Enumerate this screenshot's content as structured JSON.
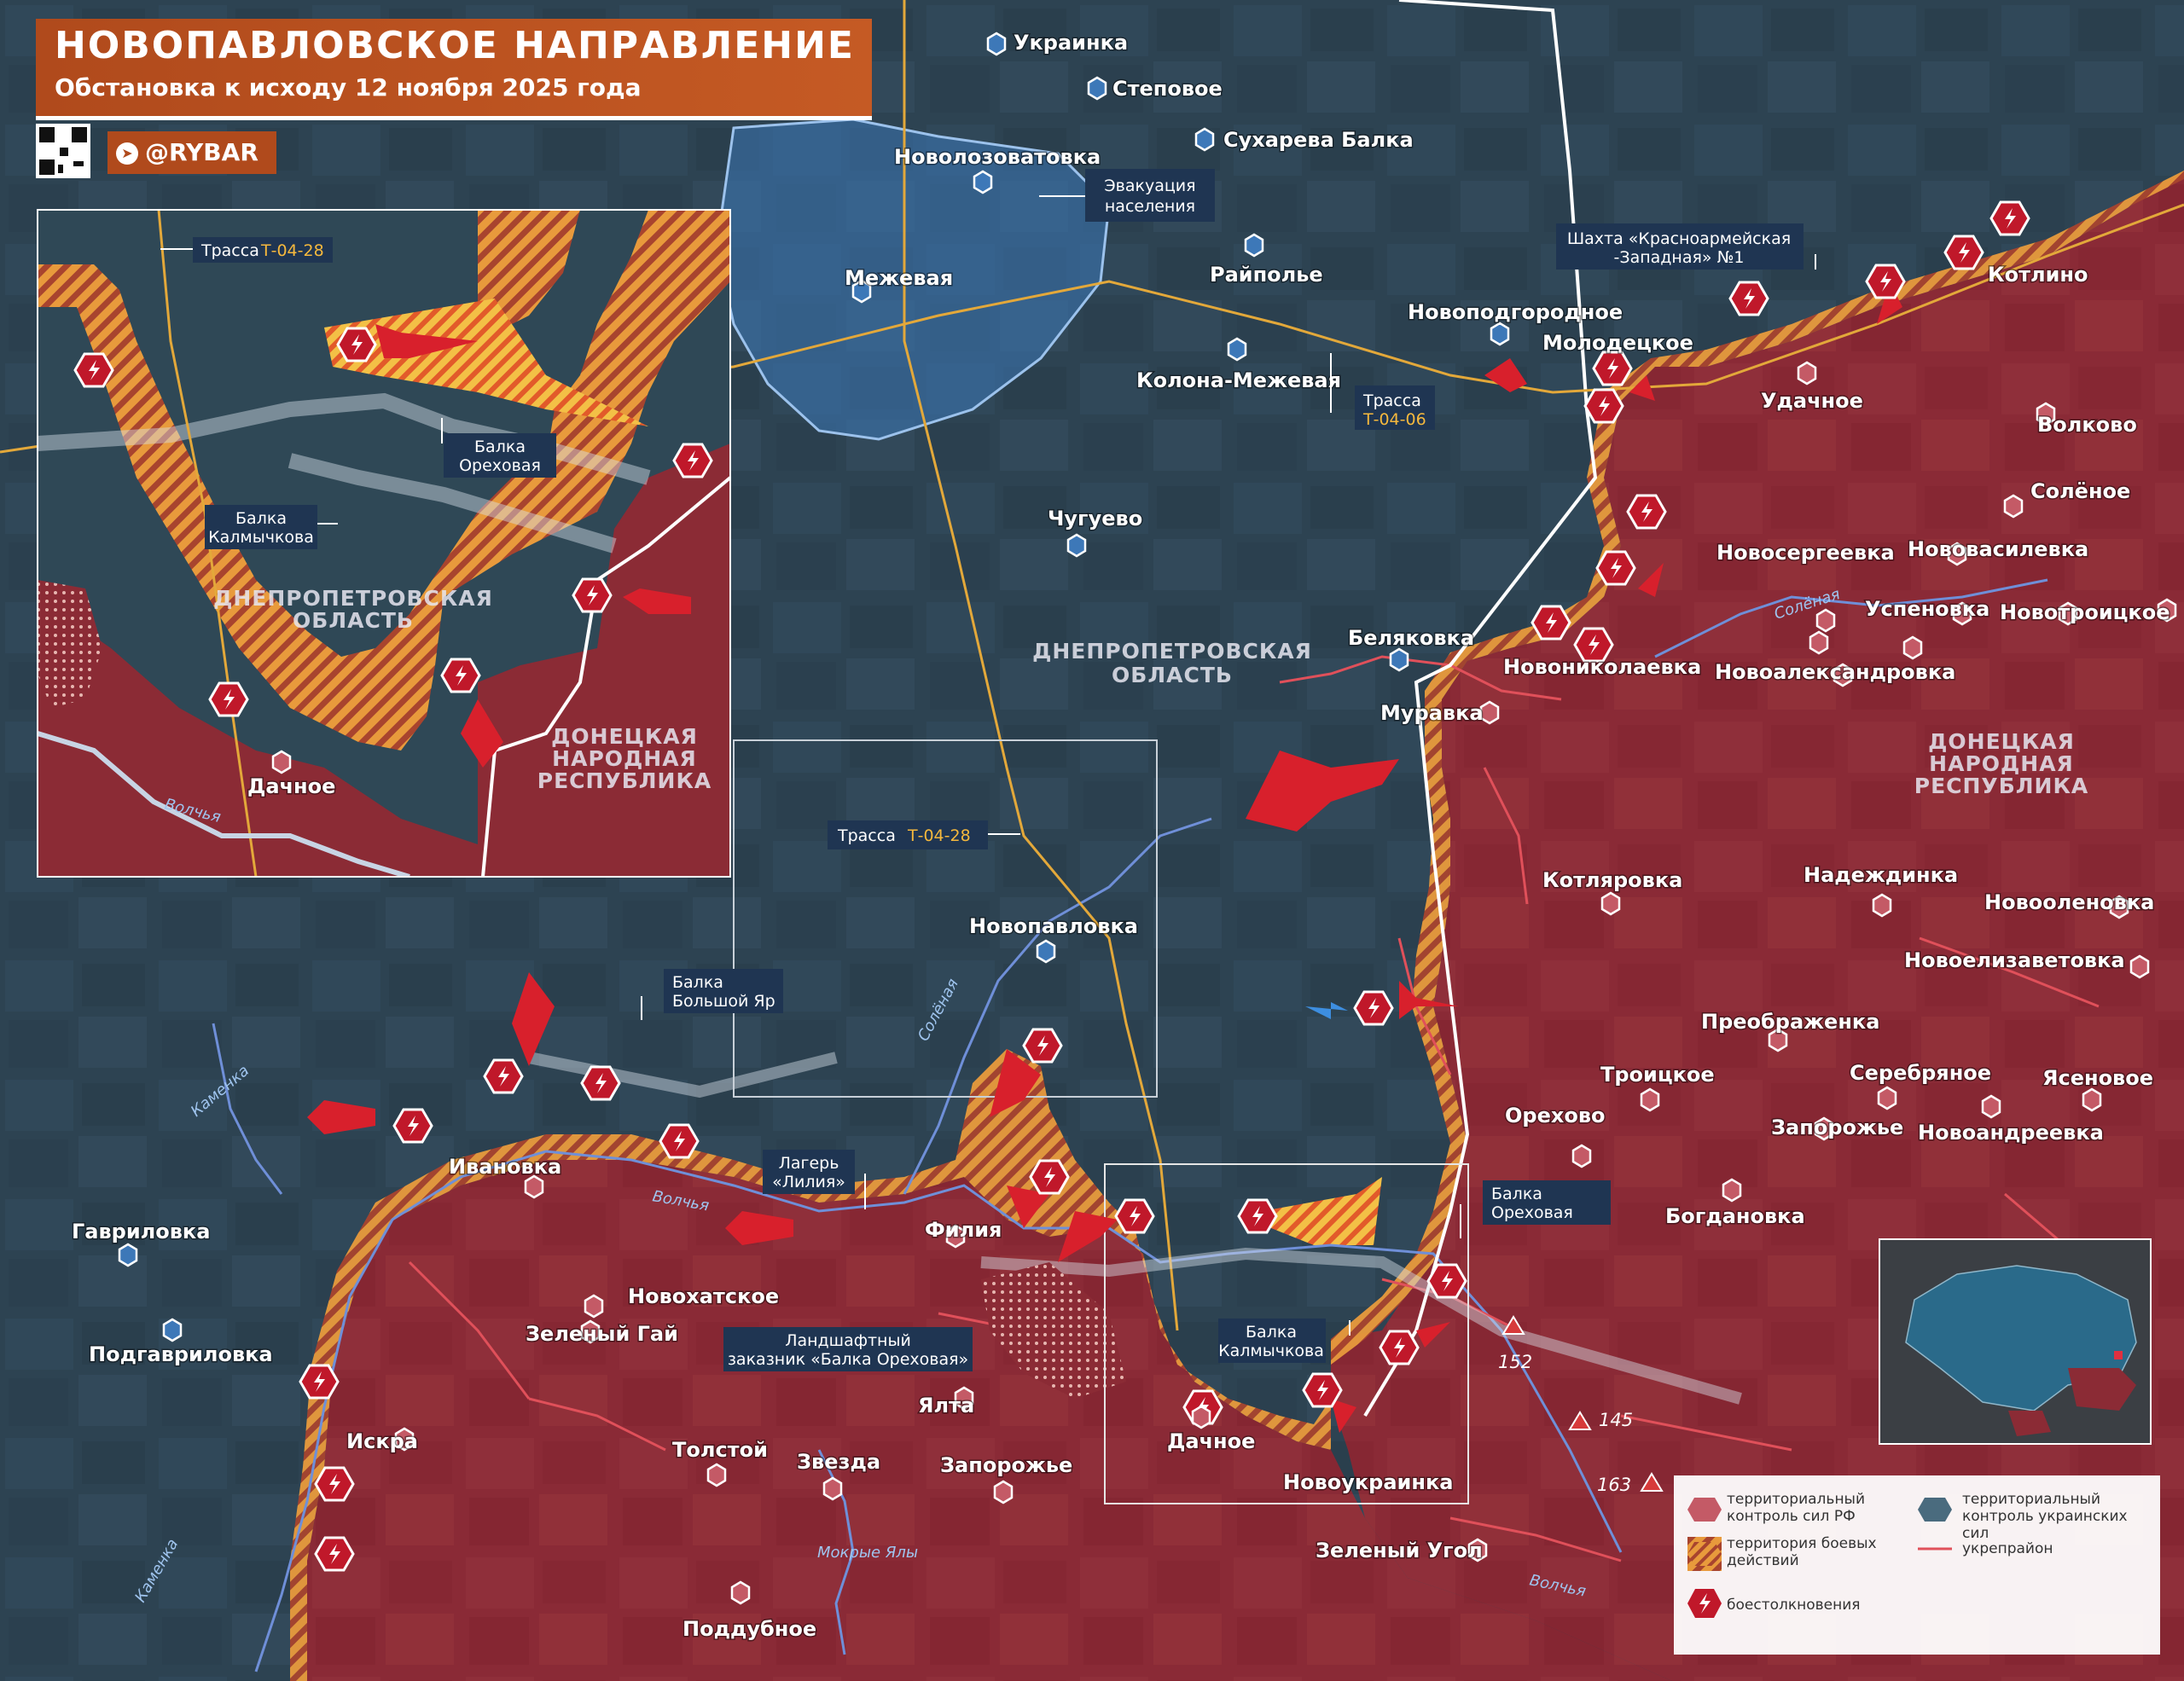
{
  "header": {
    "title": "НОВОПАВЛОВСКОЕ НАПРАВЛЕНИЕ",
    "subtitle": "Обстановка к исходу 12 ноября 2025 года",
    "brand": "@RYBAR"
  },
  "colors": {
    "russian_control": "#8b2b35",
    "contested": "#e89a3c",
    "ukrainian_control": "#2c4150",
    "evacuation": "#3d78b8",
    "clash_marker": "#c0182a",
    "fortified_line": "#e0505a"
  },
  "settlements": [
    "Украинка",
    "Степовое",
    "Новолозоватовка",
    "Сухарева Балка",
    "Межевая",
    "Райполье",
    "Новоподгородное",
    "Колона-Межевая",
    "Молодецкое",
    "Котлино",
    "Удачное",
    "Волково",
    "Солёное",
    "Чугуево",
    "Новосергеевка",
    "Нововасилевка",
    "Успеновка",
    "Новотроицкое",
    "Беляковка",
    "Новониколаевка",
    "Новоалександровка",
    "Муравка",
    "Котляровка",
    "Надеждинка",
    "Новооленовка",
    "Новопавловка",
    "Новоелизаветовка",
    "Преображенка",
    "Троицкое",
    "Серебряное",
    "Ясеновое",
    "Орехово",
    "Запорожье",
    "Новоандреевка",
    "Богдановка",
    "Ивановка",
    "Филия",
    "Гавриловка",
    "Новохатское",
    "Зеленый Гай",
    "Подгавриловка",
    "Ялта",
    "Искра",
    "Толстой",
    "Звезда",
    "Запорожье",
    "Дачное",
    "Новоукраинка",
    "Зеленый Угол",
    "Поддубное"
  ],
  "regions": {
    "dnepr_1": "ДНЕПРОПЕТРОВСКАЯ",
    "dnepr_2": "ОБЛАСТЬ",
    "donetsk_1": "ДОНЕЦКАЯ",
    "donetsk_2": "НАРОДНАЯ",
    "donetsk_3": "РЕСПУБЛИКА"
  },
  "callouts": {
    "evacuation_1": "Эвакуация",
    "evacuation_2": "населения",
    "mine_1": "Шахта «Красноармейская",
    "mine_2": "-Западная» №1",
    "road_prefix": "Трасса",
    "road_t0406": "Т-04-06",
    "road_t0428": "Т-04-28",
    "balka_bolshoy_1": "Балка",
    "balka_bolshoy_2": "Большой Яр",
    "camp_1": "Лагерь",
    "camp_2": "«Лилия»",
    "reserve_1": "Ландшафтный",
    "reserve_2": "заказник «Балка Ореховая»",
    "balka_orekh_1": "Балка",
    "balka_orekh_2": "Ореховая",
    "balka_kalm_1": "Балка",
    "balka_kalm_2": "Калмычкова"
  },
  "rivers": {
    "solenaya": "Солёная",
    "volchya": "Волчья",
    "kamenka": "Каменка",
    "mokrye_yaly": "Мокрые Ялы"
  },
  "heights": [
    "152",
    "145",
    "163"
  ],
  "inset": {
    "road_prefix": "Трасса",
    "road": "Т-04-28",
    "balka_orekh_1": "Балка",
    "balka_orekh_2": "Ореховая",
    "balka_kalm_1": "Балка",
    "balka_kalm_2": "Калмычкова",
    "region_dnepr_1": "ДНЕПРОПЕТРОВСКАЯ",
    "region_dnepr_2": "ОБЛАСТЬ",
    "region_don_1": "ДОНЕЦКАЯ",
    "region_don_2": "НАРОДНАЯ",
    "region_don_3": "РЕСПУБЛИКА",
    "village": "Дачное",
    "river": "Волчья"
  },
  "legend": {
    "rf_control": "территориальный контроль сил РФ",
    "contested": "территория боевых действий",
    "ua_control": "территориальный контроль украинских сил",
    "fortified": "укрепрайон",
    "clashes": "боестолкновения"
  }
}
